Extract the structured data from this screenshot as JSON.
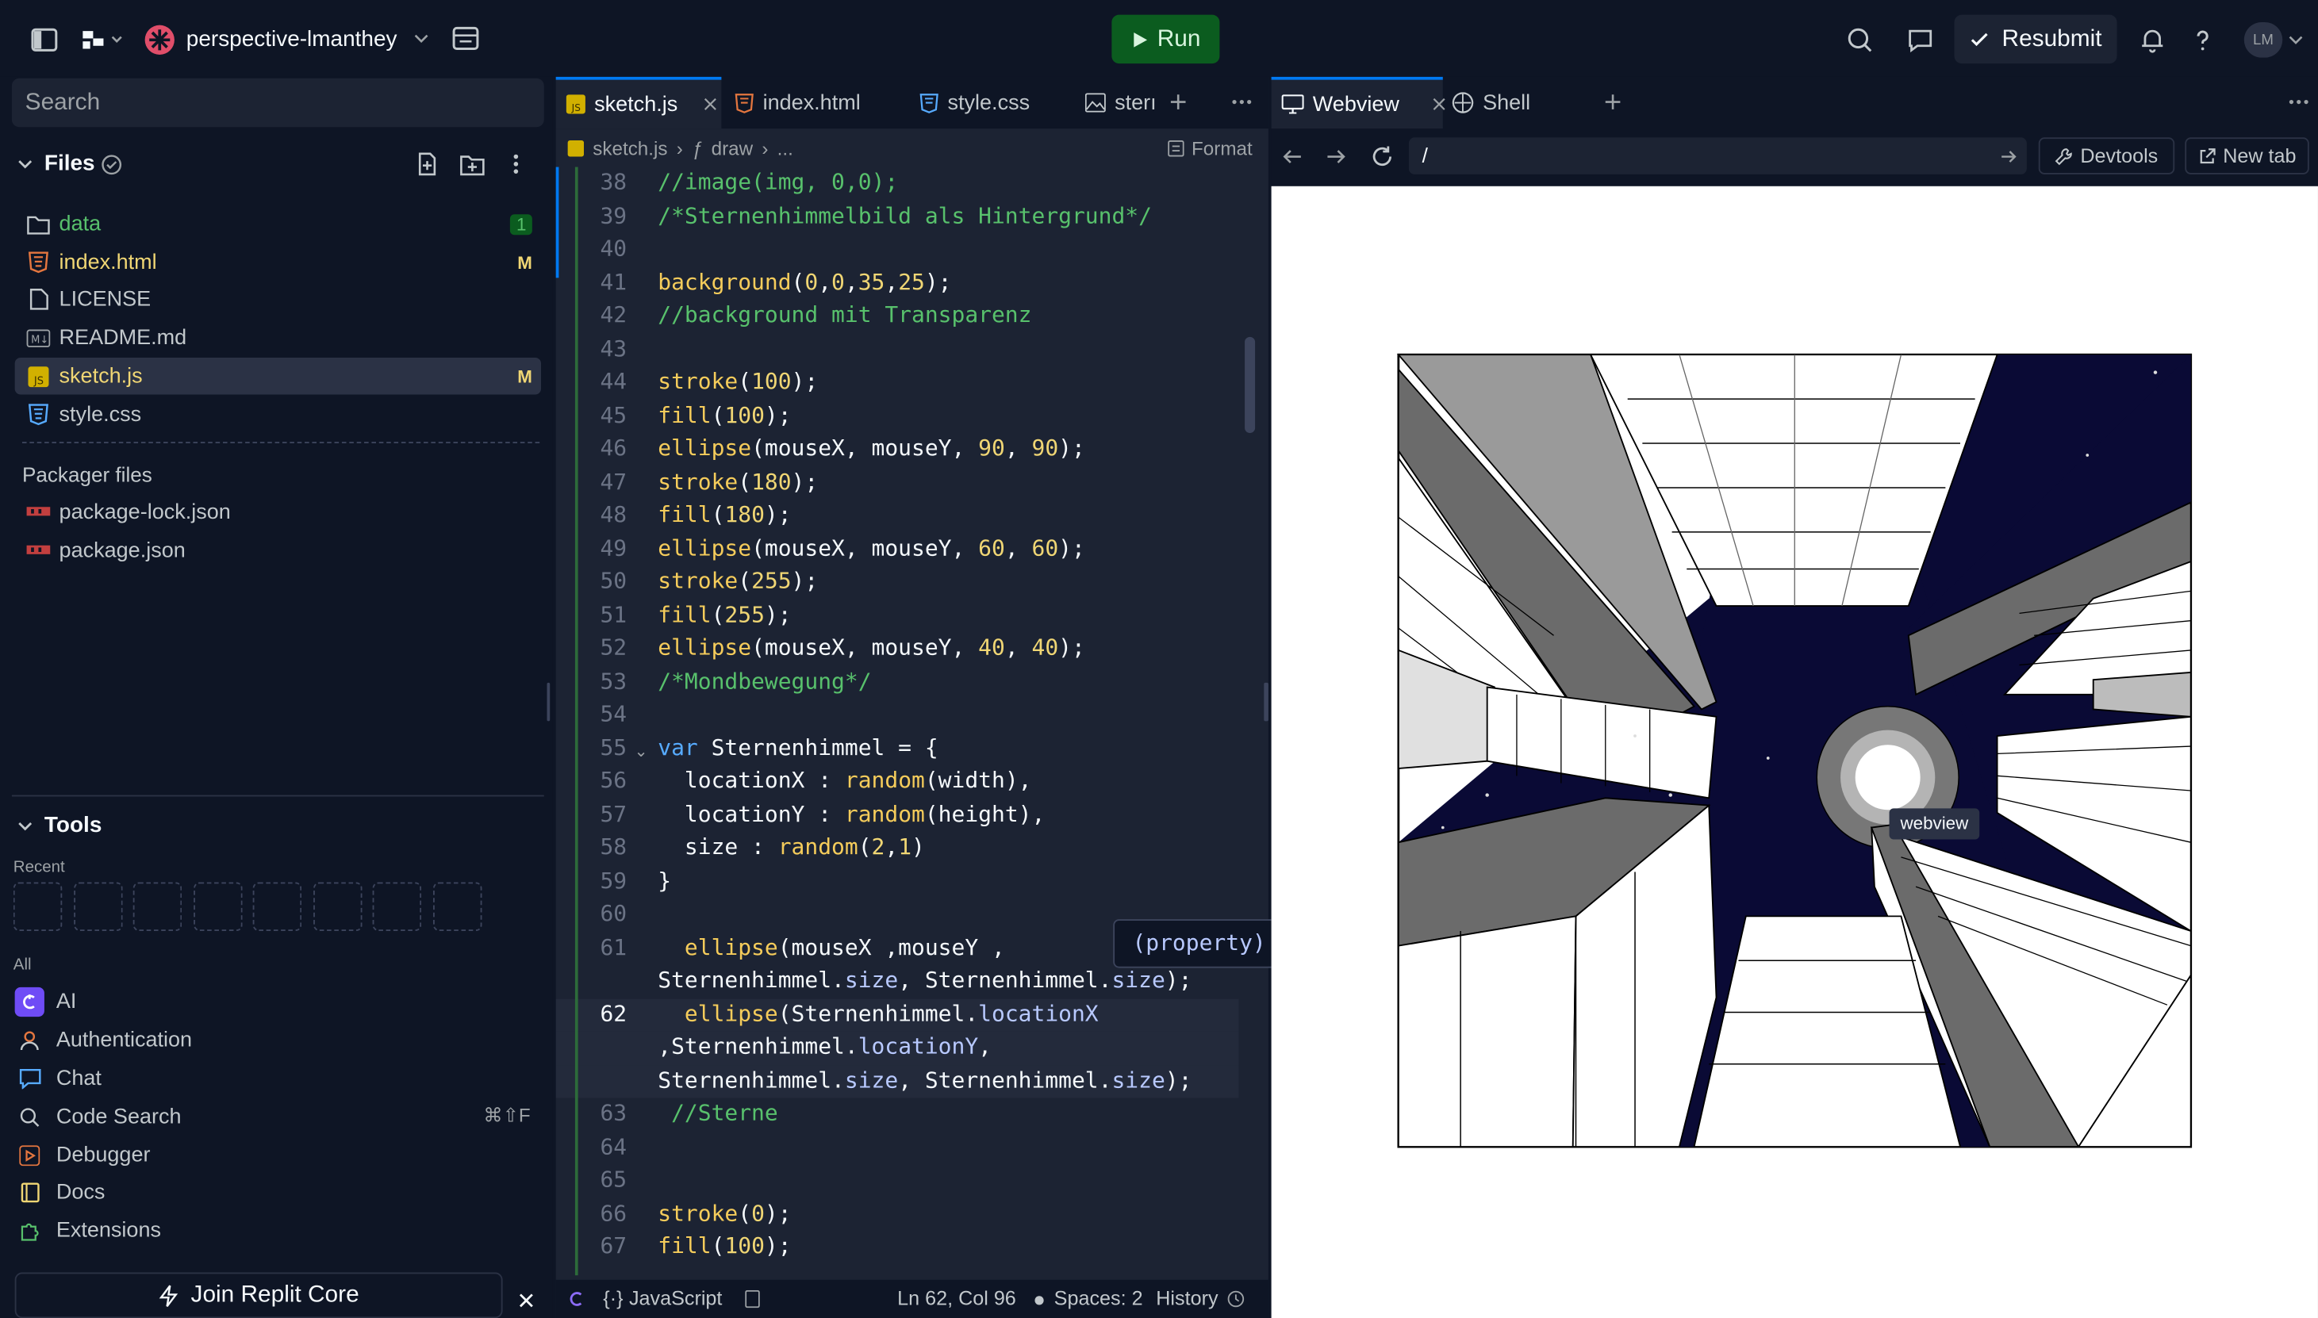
{
  "topbar": {
    "project_name": "perspective-lmanthey",
    "run_label": "Run",
    "resubmit_label": "Resubmit",
    "avatar_initials": "LM"
  },
  "sidebar": {
    "search_placeholder": "Search",
    "files_title": "Files",
    "files": [
      {
        "name": "data",
        "badge": "1",
        "icon": "folder-icon"
      },
      {
        "name": "index.html",
        "badge": "M",
        "icon": "html-file-icon"
      },
      {
        "name": "LICENSE",
        "badge": "",
        "icon": "file-icon"
      },
      {
        "name": "README.md",
        "badge": "",
        "icon": "markdown-file-icon"
      },
      {
        "name": "sketch.js",
        "badge": "M",
        "icon": "js-file-icon"
      },
      {
        "name": "style.css",
        "badge": "",
        "icon": "css-file-icon"
      }
    ],
    "packager_title": "Packager files",
    "packager_files": [
      "package-lock.json",
      "package.json"
    ],
    "tools_title": "Tools",
    "recent_label": "Recent",
    "all_label": "All",
    "tools": [
      {
        "name": "AI",
        "shortcut": ""
      },
      {
        "name": "Authentication",
        "shortcut": ""
      },
      {
        "name": "Chat",
        "shortcut": ""
      },
      {
        "name": "Code Search",
        "shortcut": "⌘⇧F"
      },
      {
        "name": "Debugger",
        "shortcut": ""
      },
      {
        "name": "Docs",
        "shortcut": ""
      },
      {
        "name": "Extensions",
        "shortcut": ""
      }
    ],
    "join_label": "Join Replit Core"
  },
  "editor": {
    "tabs": [
      "sketch.js",
      "index.html",
      "style.css",
      "sterı"
    ],
    "breadcrumb": [
      "sketch.js",
      "draw",
      "..."
    ],
    "format_label": "Format",
    "tooltip_text": "(property) size: any",
    "lines": [
      {
        "n": "38",
        "t": "//image(img, 0,0);"
      },
      {
        "n": "39",
        "t": "/*Sternenhimmelbild als Hintergrund*/"
      },
      {
        "n": "40",
        "t": ""
      },
      {
        "n": "41",
        "t": "background(0,0,35,25);"
      },
      {
        "n": "42",
        "t": "//background mit Transparenz"
      },
      {
        "n": "43",
        "t": ""
      },
      {
        "n": "44",
        "t": "stroke(100);"
      },
      {
        "n": "45",
        "t": "fill(100);"
      },
      {
        "n": "46",
        "t": "ellipse(mouseX, mouseY, 90, 90);"
      },
      {
        "n": "47",
        "t": "stroke(180);"
      },
      {
        "n": "48",
        "t": "fill(180);"
      },
      {
        "n": "49",
        "t": "ellipse(mouseX, mouseY, 60, 60);"
      },
      {
        "n": "50",
        "t": "stroke(255);"
      },
      {
        "n": "51",
        "t": "fill(255);"
      },
      {
        "n": "52",
        "t": "ellipse(mouseX, mouseY, 40, 40);"
      },
      {
        "n": "53",
        "t": "/*Mondbewegung*/"
      },
      {
        "n": "54",
        "t": ""
      },
      {
        "n": "55",
        "t": "var Sternenhimmel = {"
      },
      {
        "n": "56",
        "t": "  locationX : random(width),"
      },
      {
        "n": "57",
        "t": "  locationY : random(height),"
      },
      {
        "n": "58",
        "t": "  size : random(2,1)"
      },
      {
        "n": "59",
        "t": "}"
      },
      {
        "n": "60",
        "t": ""
      },
      {
        "n": "61",
        "t": "  ellipse(mouseX ,mouseY ,"
      },
      {
        "n": "",
        "t": "Sternenhimmel.size, Sternenhimmel.size);"
      },
      {
        "n": "62",
        "t": "  ellipse(Sternenhimmel.locationX"
      },
      {
        "n": "",
        "t": ",Sternenhimmel.locationY,"
      },
      {
        "n": "",
        "t": "Sternenhimmel.size, Sternenhimmel.size);"
      },
      {
        "n": "63",
        "t": " //Sterne"
      },
      {
        "n": "64",
        "t": ""
      },
      {
        "n": "65",
        "t": ""
      },
      {
        "n": "66",
        "t": "stroke(0);"
      },
      {
        "n": "67",
        "t": "fill(100);"
      }
    ]
  },
  "statusbar": {
    "language": "JavaScript",
    "position": "Ln 62, Col 96",
    "spaces": "Spaces: 2",
    "history": "History"
  },
  "webview": {
    "tabs": [
      "Webview",
      "Shell"
    ],
    "url": "/",
    "devtools_label": "Devtools",
    "newtab_label": "New tab",
    "hover_tooltip": "webview"
  },
  "colors": {
    "accent": "#0079f2",
    "run": "#0b5c1f",
    "bg": "#0e1525",
    "panel": "#1c2333"
  }
}
